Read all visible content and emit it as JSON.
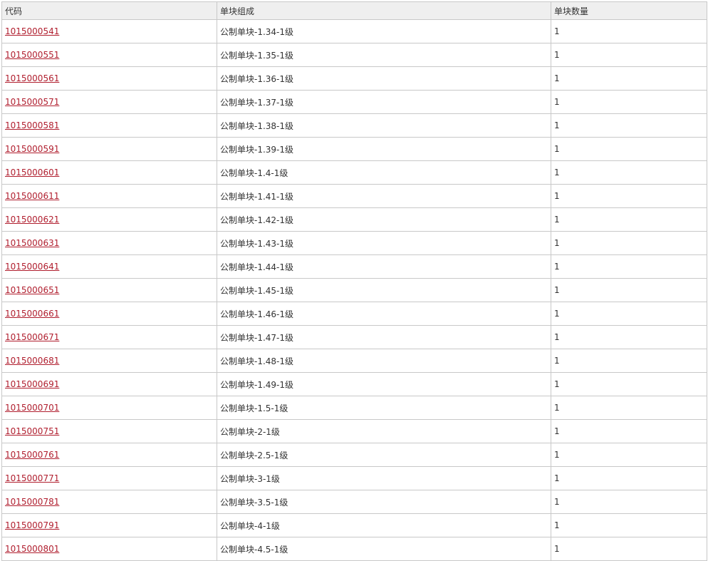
{
  "table": {
    "headers": [
      "代码",
      "单块组成",
      "单块数量"
    ],
    "rows": [
      {
        "code": "1015000541",
        "composition": "公制单块-1.34-1级",
        "quantity": "1"
      },
      {
        "code": "1015000551",
        "composition": "公制单块-1.35-1级",
        "quantity": "1"
      },
      {
        "code": "1015000561",
        "composition": "公制单块-1.36-1级",
        "quantity": "1"
      },
      {
        "code": "1015000571",
        "composition": "公制单块-1.37-1级",
        "quantity": "1"
      },
      {
        "code": "1015000581",
        "composition": "公制单块-1.38-1级",
        "quantity": "1"
      },
      {
        "code": "1015000591",
        "composition": "公制单块-1.39-1级",
        "quantity": "1"
      },
      {
        "code": "1015000601",
        "composition": "公制单块-1.4-1级",
        "quantity": "1"
      },
      {
        "code": "1015000611",
        "composition": "公制单块-1.41-1级",
        "quantity": "1"
      },
      {
        "code": "1015000621",
        "composition": "公制单块-1.42-1级",
        "quantity": "1"
      },
      {
        "code": "1015000631",
        "composition": "公制单块-1.43-1级",
        "quantity": "1"
      },
      {
        "code": "1015000641",
        "composition": "公制单块-1.44-1级",
        "quantity": "1"
      },
      {
        "code": "1015000651",
        "composition": "公制单块-1.45-1级",
        "quantity": "1"
      },
      {
        "code": "1015000661",
        "composition": "公制单块-1.46-1级",
        "quantity": "1"
      },
      {
        "code": "1015000671",
        "composition": "公制单块-1.47-1级",
        "quantity": "1"
      },
      {
        "code": "1015000681",
        "composition": "公制单块-1.48-1级",
        "quantity": "1"
      },
      {
        "code": "1015000691",
        "composition": "公制单块-1.49-1级",
        "quantity": "1"
      },
      {
        "code": "1015000701",
        "composition": "公制单块-1.5-1级",
        "quantity": "1"
      },
      {
        "code": "1015000751",
        "composition": "公制单块-2-1级",
        "quantity": "1"
      },
      {
        "code": "1015000761",
        "composition": "公制单块-2.5-1级",
        "quantity": "1"
      },
      {
        "code": "1015000771",
        "composition": "公制单块-3-1级",
        "quantity": "1"
      },
      {
        "code": "1015000781",
        "composition": "公制单块-3.5-1级",
        "quantity": "1"
      },
      {
        "code": "1015000791",
        "composition": "公制单块-4-1级",
        "quantity": "1"
      },
      {
        "code": "1015000801",
        "composition": "公制单块-4.5-1级",
        "quantity": "1"
      }
    ]
  }
}
